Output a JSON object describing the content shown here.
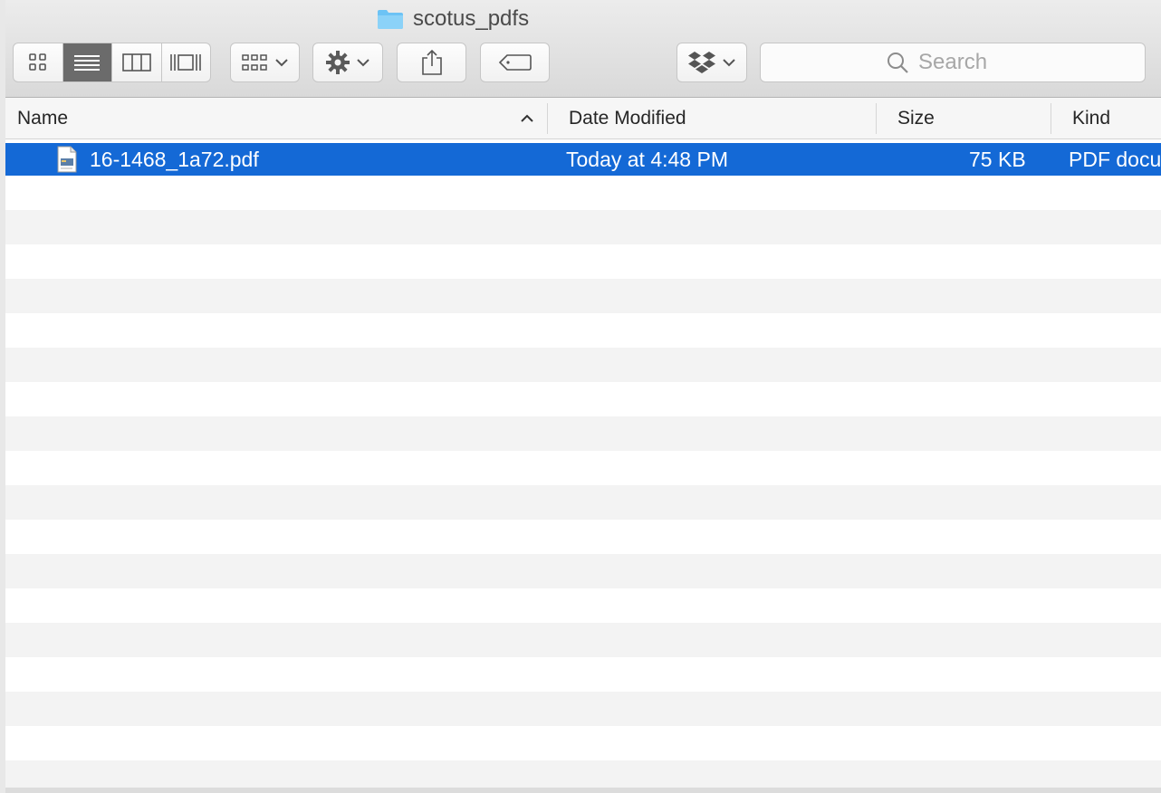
{
  "window": {
    "title": "scotus_pdfs"
  },
  "toolbar": {
    "view_buttons": [
      "icon-view",
      "list-view",
      "column-view",
      "cover-flow-view"
    ],
    "search_placeholder": "Search"
  },
  "columns": {
    "name": "Name",
    "date": "Date Modified",
    "size": "Size",
    "kind": "Kind"
  },
  "files": [
    {
      "name": "16-1468_1a72.pdf",
      "date": "Today at 4:48 PM",
      "size": "75 KB",
      "kind": "PDF docu"
    }
  ],
  "colors": {
    "selection": "#1469d6",
    "folder": "#6cc3f5"
  }
}
